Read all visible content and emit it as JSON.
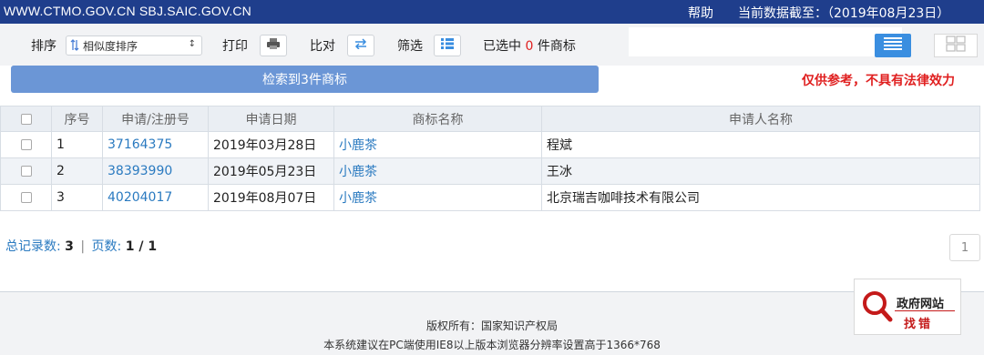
{
  "topbar": {
    "site": "WWW.CTMO.GOV.CN SBJ.SAIC.GOV.CN",
    "help": "帮助",
    "as_of": "当前数据截至：（2019年08月23日）"
  },
  "toolbar": {
    "sort_label": "排序",
    "sort_value": "相似度排序",
    "print_label": "打印",
    "compare_label": "比对",
    "filter_label": "筛选",
    "selected_prefix": "已选中",
    "selected_count": "0",
    "selected_suffix": "件商标"
  },
  "result_banner": "检索到3件商标",
  "disclaimer": "仅供参考，不具有法律效力",
  "table": {
    "headers": [
      "序号",
      "申请/注册号",
      "申请日期",
      "商标名称",
      "申请人名称"
    ],
    "rows": [
      {
        "index": "1",
        "reg_no": "37164375",
        "date": "2019年03月28日",
        "name": "小鹿茶",
        "applicant": "程斌"
      },
      {
        "index": "2",
        "reg_no": "38393990",
        "date": "2019年05月23日",
        "name": "小鹿茶",
        "applicant": "王冰"
      },
      {
        "index": "3",
        "reg_no": "40204017",
        "date": "2019年08月07日",
        "name": "小鹿茶",
        "applicant": "北京瑞吉咖啡技术有限公司"
      }
    ]
  },
  "records": {
    "total_label": "总记录数:",
    "total_value": "3",
    "pages_label": "页数:",
    "pages_value": "1 / 1"
  },
  "pager": {
    "current": "1"
  },
  "footer": {
    "copyright": "版权所有：国家知识产权局",
    "note": "本系统建议在PC端使用IE8以上版本浏览器分辨率设置高于1366*768"
  },
  "gov_badge": {
    "line1": "政府网站",
    "line2": "找错"
  },
  "colors": {
    "topbar": "#1f3e8c",
    "banner": "#6b96d6",
    "link": "#2a7ac0",
    "alert": "#e02020",
    "active_view": "#3a8ee0"
  },
  "icons": {
    "print": "printer-icon",
    "compare": "compare-arrows-icon",
    "filter": "list-filter-icon",
    "list_view": "list-view-icon",
    "grid_view": "grid-view-icon",
    "sort": "sort-icon",
    "badge": "magnifier-icon"
  }
}
